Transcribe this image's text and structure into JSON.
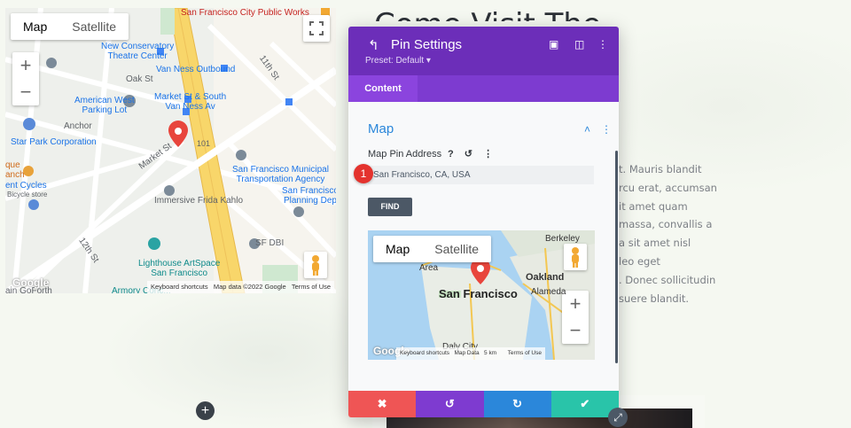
{
  "page": {
    "heading": "Come Visit The",
    "body_lines": [
      "t. Mauris blandit",
      "rcu erat, accumsan",
      "it amet quam",
      "massa, convallis a",
      "a sit amet nisl",
      "leo eget",
      ". Donec sollicitudin",
      "suere blandit."
    ],
    "add_icon": "+"
  },
  "left_map": {
    "maptype_map": "Map",
    "maptype_satellite": "Satellite",
    "zoom_in": "+",
    "zoom_out": "−",
    "labels": {
      "sf_public_works": "San Francisco\nCity Public Works",
      "new_conservatory": "New Conservatory\nTheatre Center",
      "van_ness_outbound": "Van Ness Outbound",
      "oak_st": "Oak St",
      "eleventh_st": "11th St",
      "american_west": "American West\nParking Lot",
      "market_south": "Market St & South\nVan Ness Av",
      "anchor": "Anchor",
      "star_park": "Star Park Corporation",
      "que_ranch": "que\nanch",
      "ent_cycles": "ent Cycles",
      "bicycle_store": "Bicycle store",
      "market_st": "Market St",
      "route_101": "101",
      "sfmta": "San Francisco Municipal\nTransportation Agency",
      "sf_planning": "San Francisco\nPlanning Dep",
      "frida": "Immersive Frida Kahlo",
      "sf_dbi": "SF DBI",
      "twelfth_st": "12th St",
      "lighthouse": "Lighthouse ArtSpace\nSan Francisco",
      "armory": "Armory Conc...",
      "goforth": "ain GoForth"
    },
    "attribution": {
      "shortcuts": "Keyboard shortcuts",
      "mapdata": "Map data ©2022 Google",
      "terms": "Terms of Use"
    },
    "google": "Google"
  },
  "panel": {
    "title": "Pin Settings",
    "preset": "Preset: Default ▾",
    "tab_content": "Content",
    "section_title": "Map",
    "field_label": "Map Pin Address",
    "help_icon": "?",
    "reset_icon": "↺",
    "more_icon": "⋮",
    "address_value": "San Francisco, CA, USA",
    "badge": "1",
    "find_label": "FIND",
    "mini_map": {
      "maptype_map": "Map",
      "maptype_satellite": "Satellite",
      "city": "San Francisco",
      "oakland": "Oakland",
      "alameda": "Alameda",
      "berkeley": "Berkeley",
      "area": "Area",
      "daly_city": "Daly City",
      "shortcuts": "Keyboard shortcuts",
      "mapdata": "Map Data",
      "scale": "5 km",
      "terms": "Terms of Use",
      "google": "Google",
      "zoom_in": "+",
      "zoom_out": "−"
    },
    "footer": {
      "cancel": "✖",
      "undo": "↺",
      "redo": "↻",
      "save": "✔"
    },
    "colors": {
      "header": "#6c2eb9",
      "cancel": "#ef5555",
      "undo": "#7e3bd0",
      "redo": "#2b87da",
      "save": "#29c4a9"
    }
  }
}
